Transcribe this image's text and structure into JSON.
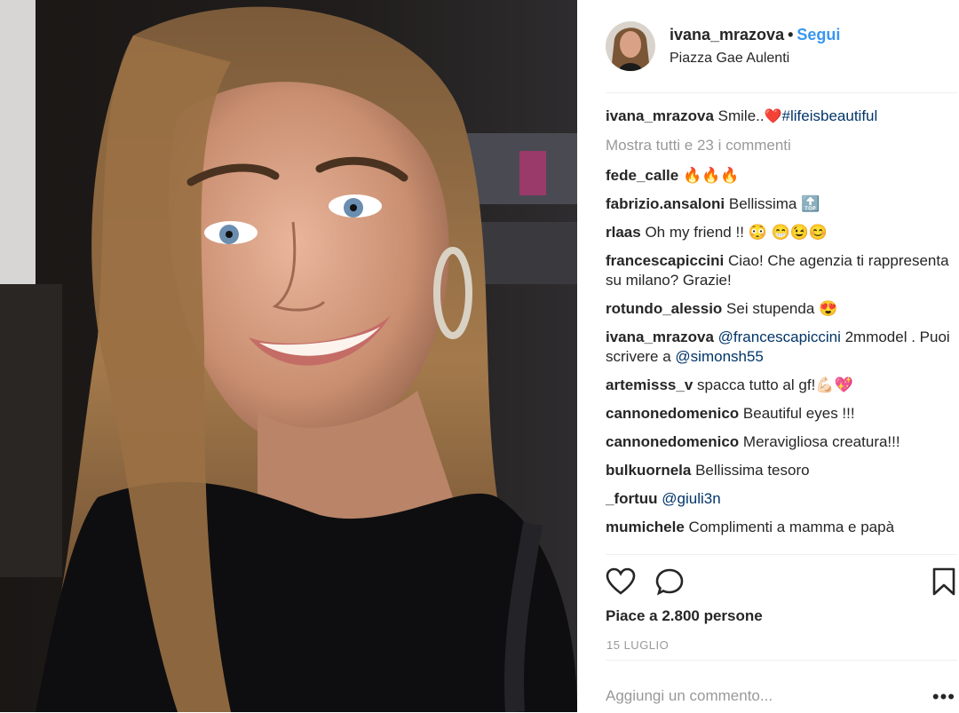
{
  "post": {
    "username": "ivana_mrazova",
    "separator": "•",
    "follow_label": "Segui",
    "location": "Piazza Gae Aulenti"
  },
  "caption": {
    "username": "ivana_mrazova",
    "text": "Smile..",
    "emoji": "❤️",
    "hashtag": "#lifeisbeautiful"
  },
  "show_all_label": "Mostra tutti e 23 i commenti",
  "comments": [
    {
      "user": "fede_calle",
      "text": "🔥🔥🔥"
    },
    {
      "user": "fabrizio.ansaloni",
      "text": "Bellissima 🔝"
    },
    {
      "user": "rlaas",
      "text": "Oh my friend !! 😳 😁😉😊"
    },
    {
      "user": "francescapiccini",
      "text": "Ciao! Che agenzia ti rappresenta su milano? Grazie!"
    },
    {
      "user": "rotundo_alessio",
      "text": "Sei stupenda 😍"
    },
    {
      "user": "ivana_mrazova",
      "mention1": "@francescapiccini",
      "text_mid": "2mmodel . Puoi scrivere a",
      "mention2": "@simonsh55"
    },
    {
      "user": "artemisss_v",
      "text": "spacca tutto al gf!💪🏻💖"
    },
    {
      "user": "cannonedomenico",
      "text": "Beautiful eyes !!!"
    },
    {
      "user": "cannonedomenico",
      "text": "Meravigliosa creatura!!!"
    },
    {
      "user": "bulkuornela",
      "text": "Bellissima tesoro"
    },
    {
      "user": "_fortuu",
      "mention1": "@giuli3n"
    },
    {
      "user": "mumichele",
      "text": "Complimenti a mamma e papà"
    }
  ],
  "likes_label": "Piace a 2.800 persone",
  "date_label": "15 LUGLIO",
  "add_comment_placeholder": "Aggiungi un commento...",
  "more_options": "•••",
  "icons": {
    "like": "heart-icon",
    "comment": "comment-icon",
    "save": "bookmark-icon",
    "more": "more-options-icon"
  }
}
